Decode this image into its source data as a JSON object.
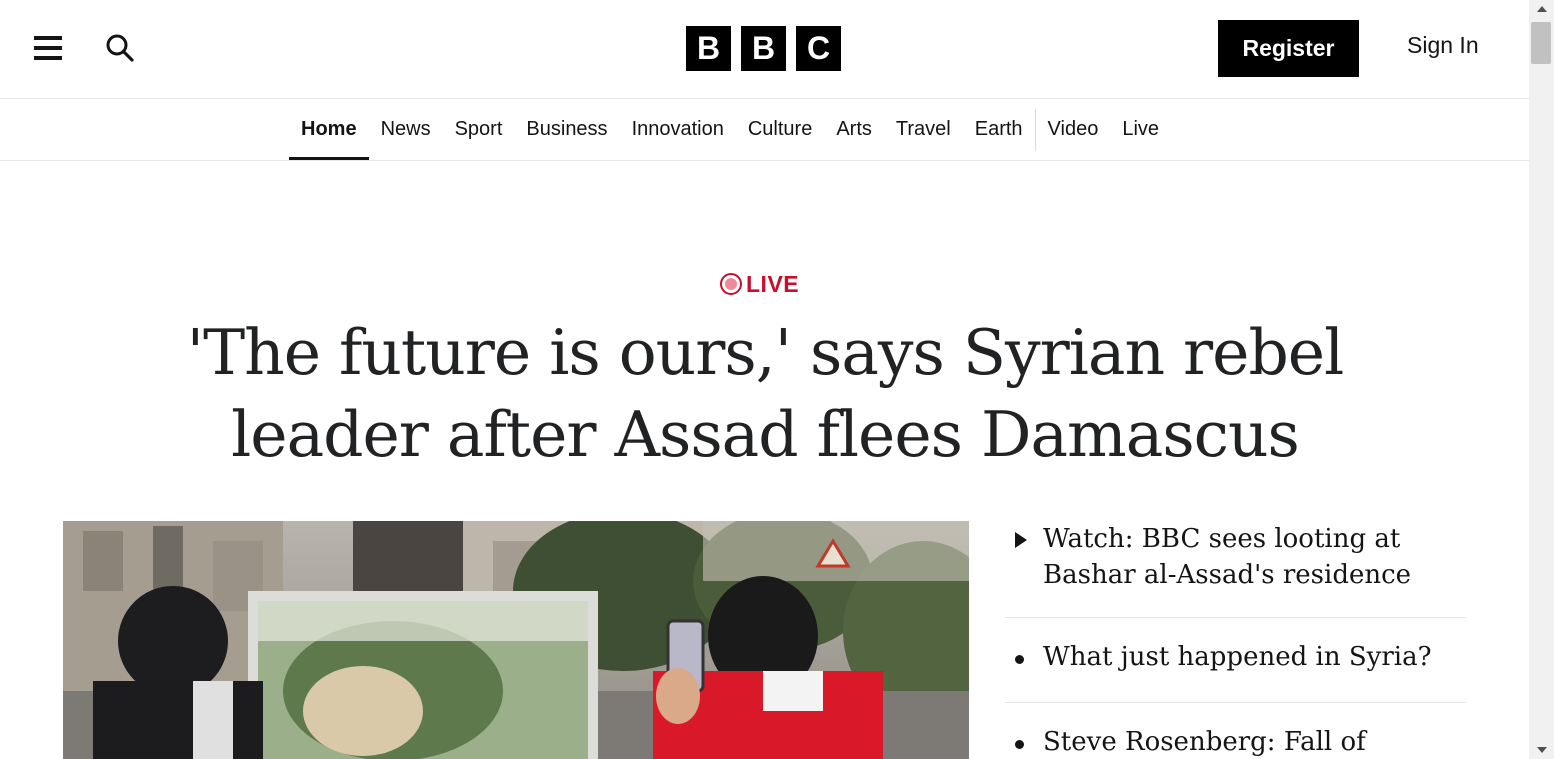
{
  "header": {
    "menu_icon": "hamburger-menu-icon",
    "search_icon": "search-icon",
    "logo_letters": [
      "B",
      "B",
      "C"
    ],
    "register_label": "Register",
    "signin_label": "Sign In"
  },
  "nav": {
    "items": [
      {
        "label": "Home",
        "active": true
      },
      {
        "label": "News"
      },
      {
        "label": "Sport"
      },
      {
        "label": "Business"
      },
      {
        "label": "Innovation"
      },
      {
        "label": "Culture"
      },
      {
        "label": "Arts"
      },
      {
        "label": "Travel"
      },
      {
        "label": "Earth"
      },
      {
        "label": "Video"
      },
      {
        "label": "Live"
      }
    ]
  },
  "lead": {
    "live_label": "LIVE",
    "headline": "'The future is ours,' says Syrian rebel leader after Assad flees Damascus"
  },
  "related": [
    {
      "icon": "play-icon",
      "text": "Watch: BBC sees looting at Bashar al-Assad's residence"
    },
    {
      "icon": "bullet-icon",
      "text": "What just happened in Syria?"
    },
    {
      "icon": "bullet-icon",
      "text": "Steve Rosenberg: Fall of"
    }
  ],
  "colors": {
    "live_red": "#c8102e",
    "text": "#141414",
    "headline": "#202224",
    "divider": "#e6e6e6"
  }
}
